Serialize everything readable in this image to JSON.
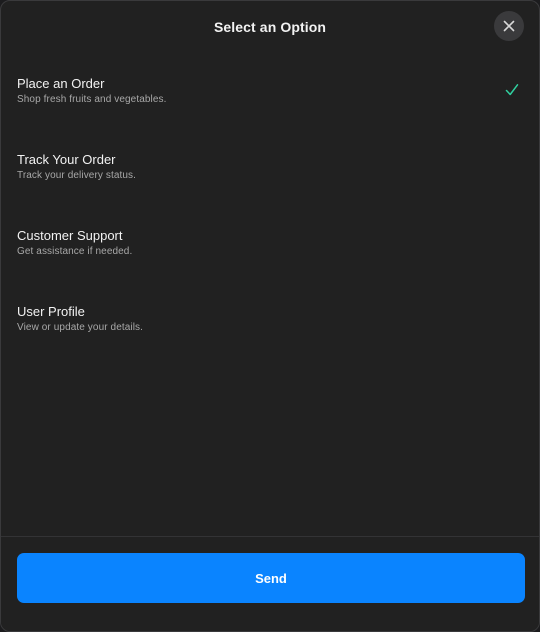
{
  "dialog": {
    "title": "Select an Option",
    "close_icon": "close-icon"
  },
  "options": [
    {
      "label": "Place an Order",
      "description": "Shop fresh fruits and vegetables.",
      "selected": true
    },
    {
      "label": "Track Your Order",
      "description": "Track your delivery status.",
      "selected": false
    },
    {
      "label": "Customer Support",
      "description": "Get assistance if needed.",
      "selected": false
    },
    {
      "label": "User Profile",
      "description": "View or update your details.",
      "selected": false
    }
  ],
  "footer": {
    "send_label": "Send"
  },
  "colors": {
    "accent": "#0a84ff",
    "check": "#30d1a0",
    "background": "#212121"
  }
}
